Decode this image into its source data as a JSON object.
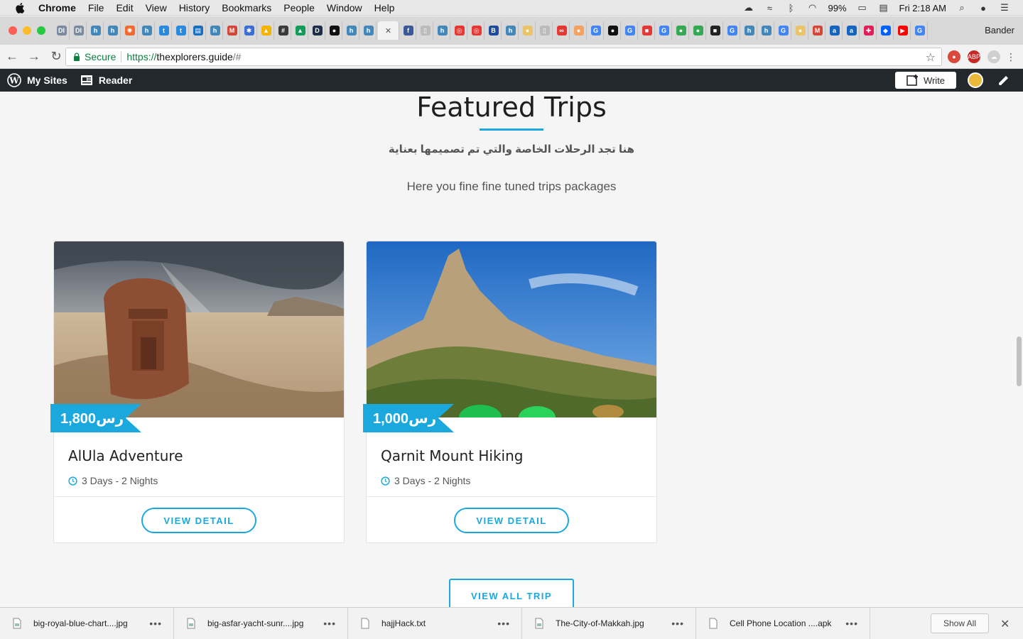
{
  "menubar": {
    "app": "Chrome",
    "menus": [
      "File",
      "Edit",
      "View",
      "History",
      "Bookmarks",
      "People",
      "Window",
      "Help"
    ],
    "battery": "99%",
    "clock": "Fri 2:18 AM"
  },
  "browser": {
    "profile_name": "Bander",
    "secure_label": "Secure",
    "url_scheme": "https://",
    "url_host": "thexplorers.guide",
    "url_rest": "/#"
  },
  "wp_bar": {
    "my_sites": "My Sites",
    "reader": "Reader",
    "write": "Write"
  },
  "section": {
    "title": "Featured Trips",
    "subtitle_ar": "هنا تجد الرحلات الخاصة والتي تم تصميمها بعناية",
    "subtitle_en": "Here you fine fine tuned trips packages"
  },
  "trips": [
    {
      "name": "AlUla Adventure",
      "price": "1,800رس",
      "duration": "3 Days - 2 Nights",
      "button": "VIEW DETAIL"
    },
    {
      "name": "Qarnit Mount Hiking",
      "price": "1,000رس",
      "duration": "3 Days - 2 Nights",
      "button": "VIEW DETAIL"
    }
  ],
  "view_all": "VIEW ALL TRIP",
  "downloads": {
    "items": [
      "big-royal-blue-chart....jpg",
      "big-asfar-yacht-sunr....jpg",
      "hajjHack.txt",
      "The-City-of-Makkah.jpg",
      "Cell Phone Location ....apk"
    ],
    "show_all": "Show All"
  },
  "colors": {
    "accent": "#1aa8dd",
    "wp_bar": "#23282d",
    "secure_green": "#0b8043"
  }
}
